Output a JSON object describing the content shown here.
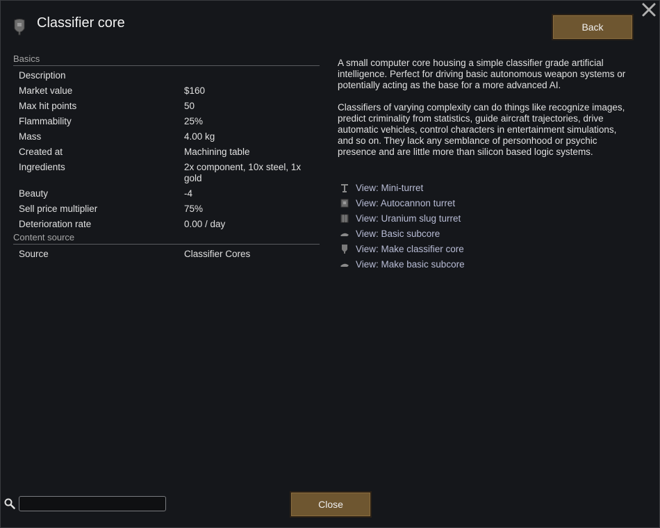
{
  "header": {
    "title": "Classifier core"
  },
  "buttons": {
    "back": "Back",
    "close": "Close"
  },
  "sections": [
    {
      "title": "Basics",
      "rows": [
        {
          "label": "Description",
          "value": ""
        },
        {
          "label": "Market value",
          "value": "$160"
        },
        {
          "label": "Max hit points",
          "value": "50"
        },
        {
          "label": "Flammability",
          "value": "25%"
        },
        {
          "label": "Mass",
          "value": "4.00 kg"
        },
        {
          "label": "Created at",
          "value": "Machining table"
        },
        {
          "label": "Ingredients",
          "value": "2x component, 10x steel, 1x gold"
        },
        {
          "label": "Beauty",
          "value": "-4"
        },
        {
          "label": "Sell price multiplier",
          "value": "75%"
        },
        {
          "label": "Deterioration rate",
          "value": "0.00 / day"
        }
      ]
    },
    {
      "title": "Content source",
      "rows": [
        {
          "label": "Source",
          "value": "Classifier Cores"
        }
      ]
    }
  ],
  "description": {
    "para1": "A small computer core housing a simple classifier grade artificial intelligence. Perfect for driving basic autonomous weapon systems or potentially acting as the base for a more advanced AI.",
    "para2": "Classifiers of varying complexity can do things like recognize images, predict criminality from statistics, guide aircraft trajectories, drive automatic vehicles, control characters in entertainment simulations, and so on. They lack any semblance of personhood or psychic presence and are little more than silicon based logic systems."
  },
  "links": [
    {
      "label": "View: Mini-turret",
      "icon": "mini-turret-icon"
    },
    {
      "label": "View: Autocannon turret",
      "icon": "autocannon-turret-icon"
    },
    {
      "label": "View: Uranium slug turret",
      "icon": "uranium-slug-turret-icon"
    },
    {
      "label": "View: Basic subcore",
      "icon": "basic-subcore-icon"
    },
    {
      "label": "View: Make classifier core",
      "icon": "classifier-core-icon"
    },
    {
      "label": "View: Make basic subcore",
      "icon": "basic-subcore-icon"
    }
  ],
  "search": {
    "value": "",
    "placeholder": ""
  }
}
